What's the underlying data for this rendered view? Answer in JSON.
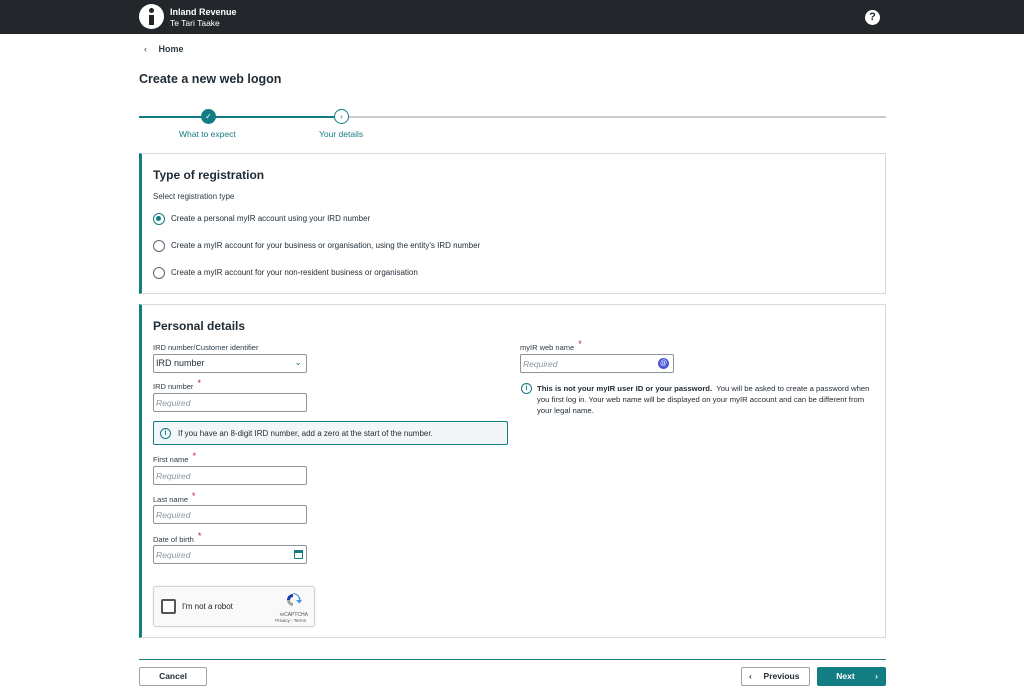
{
  "header": {
    "brand_line1": "Inland Revenue",
    "brand_line2": "Te Tari Taake",
    "help_glyph": "?"
  },
  "breadcrumb": {
    "home": "Home"
  },
  "page_title": "Create a new web logon",
  "stepper": {
    "steps": [
      {
        "label": "What to expect",
        "state": "complete"
      },
      {
        "label": "Your details",
        "state": "current"
      }
    ]
  },
  "registration": {
    "title": "Type of registration",
    "subtitle": "Select registration type",
    "options": [
      {
        "label": "Create a personal myIR account using your IRD number",
        "selected": true
      },
      {
        "label": "Create a myIR account for your business or organisation, using the entity's IRD number",
        "selected": false
      },
      {
        "label": "Create a myIR account for your non-resident business or organisation",
        "selected": false
      }
    ]
  },
  "personal": {
    "title": "Personal details",
    "identifier_label": "IRD number/Customer identifier",
    "identifier_value": "IRD number",
    "ird_label": "IRD number",
    "ird_placeholder": "Required",
    "ird_hint": "If you have an 8-digit IRD number, add a zero at the start of the number.",
    "first_name_label": "First name",
    "first_name_placeholder": "Required",
    "last_name_label": "Last name",
    "last_name_placeholder": "Required",
    "dob_label": "Date of birth",
    "dob_placeholder": "Required",
    "webname_label": "myIR web name",
    "webname_placeholder": "Required",
    "webname_note_bold": "This is not your myIR user ID or your password.",
    "webname_note_rest": "You will be asked to create a password when you first log in. Your web name will be displayed on your myIR account and can be different from your legal name.",
    "required_mark": "*"
  },
  "captcha": {
    "label": "I'm not a robot",
    "brand": "reCAPTCHA",
    "terms": "Privacy - Terms"
  },
  "footer": {
    "cancel": "Cancel",
    "previous": "Previous",
    "next": "Next"
  },
  "colors": {
    "accent": "#137d84",
    "topbar": "#23272b",
    "required": "#c8102e"
  }
}
